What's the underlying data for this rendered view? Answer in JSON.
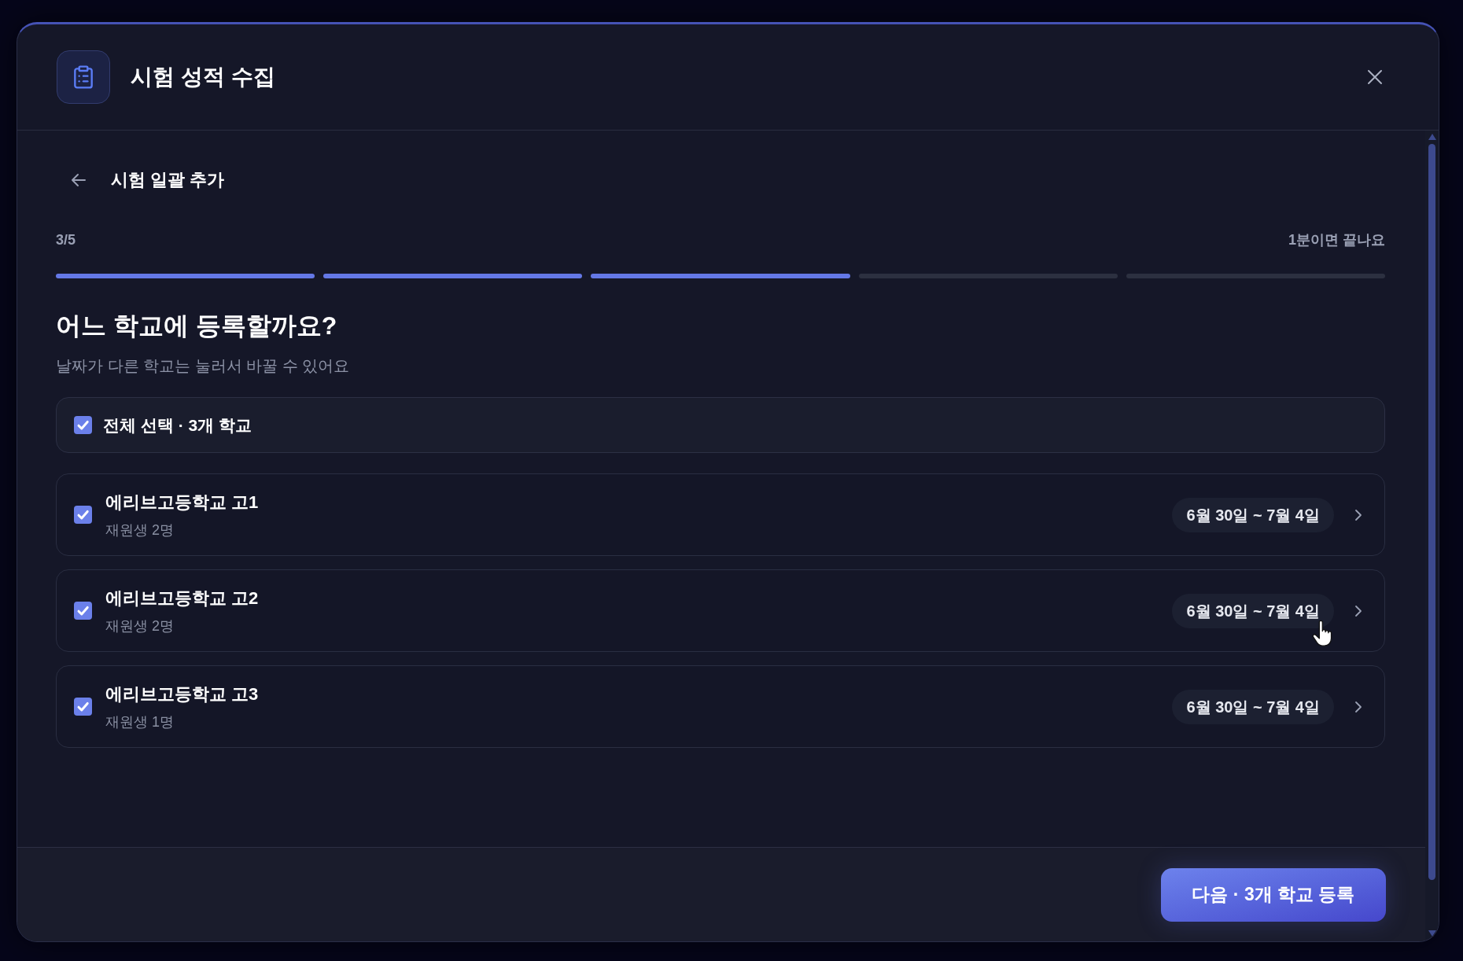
{
  "window": {
    "title": "시험 성적 수집"
  },
  "page": {
    "title": "시험 일괄 추가"
  },
  "progress": {
    "step": "3/5",
    "hint": "1분이면 끝나요",
    "segments": [
      {
        "filled": true
      },
      {
        "filled": true
      },
      {
        "filled": true
      },
      {
        "filled": false
      },
      {
        "filled": false
      }
    ]
  },
  "question": {
    "heading": "어느 학교에 등록할까요?",
    "description": "날짜가 다른 학교는 눌러서 바꿀 수 있어요"
  },
  "select_all": {
    "label": "전체 선택 · 3개 학교",
    "checked": true
  },
  "schools": [
    {
      "name": "에리브고등학교 고1",
      "students": "재원생 2명",
      "dates": "6월 30일 ~ 7월 4일",
      "checked": true
    },
    {
      "name": "에리브고등학교 고2",
      "students": "재원생 2명",
      "dates": "6월 30일 ~ 7월 4일",
      "checked": true
    },
    {
      "name": "에리브고등학교 고3",
      "students": "재원생 1명",
      "dates": "6월 30일 ~ 7월 4일",
      "checked": true
    }
  ],
  "footer": {
    "next_button": "다음 · 3개 학교 등록"
  }
}
